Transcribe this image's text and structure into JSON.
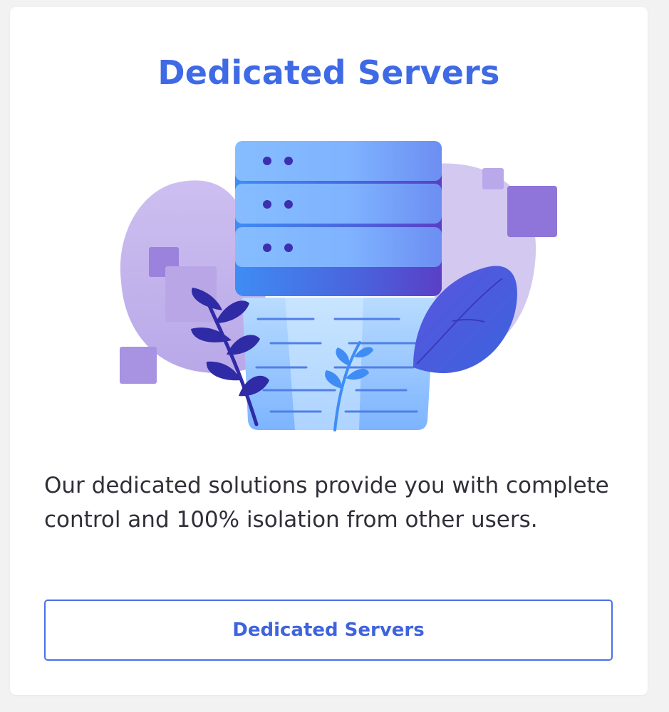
{
  "card": {
    "title": "Dedicated Servers",
    "illustration_icon": "dedicated-server-stack-icon",
    "description": "Our dedicated solutions provide you with complete control and 100% isolation from other users.",
    "button_label": "Dedicated Servers"
  },
  "colors": {
    "accent": "#3f6ae6",
    "text": "#2f2f38",
    "server_light": "#8fc1ff",
    "server_dark": "#5a46c8",
    "blob": "#cfc3ee",
    "leaf": "#3f4fd8",
    "stem": "#2f2aa6"
  }
}
